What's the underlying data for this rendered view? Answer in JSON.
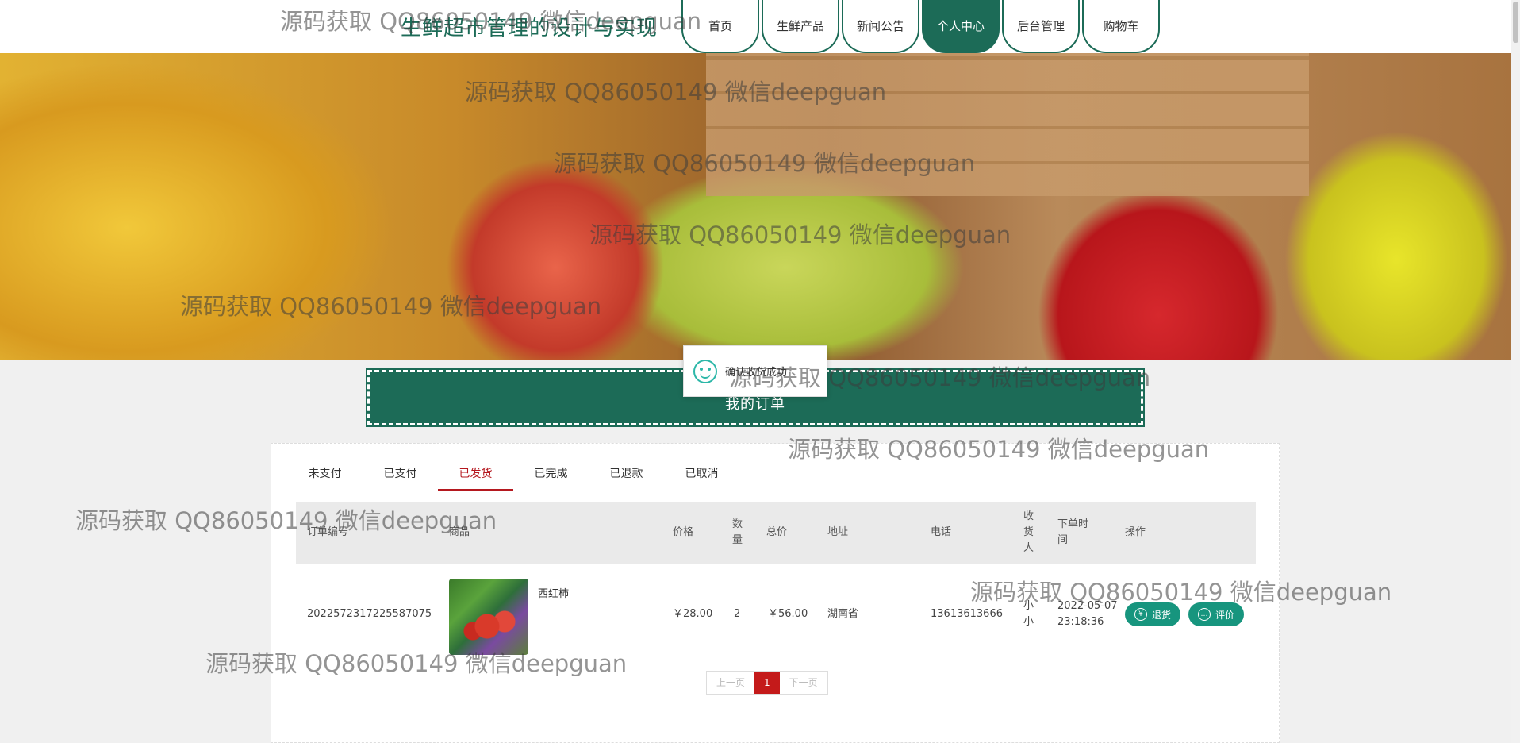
{
  "header": {
    "title": "生鲜超市管理的设计与实现",
    "nav": [
      {
        "label": "首页",
        "active": false
      },
      {
        "label": "生鲜产品",
        "active": false
      },
      {
        "label": "新闻公告",
        "active": false
      },
      {
        "label": "个人中心",
        "active": true
      },
      {
        "label": "后台管理",
        "active": false
      },
      {
        "label": "购物车",
        "active": false
      }
    ]
  },
  "toast": {
    "text": "确认收货成功"
  },
  "section": {
    "title": "我的订单"
  },
  "tabs": [
    "未支付",
    "已支付",
    "已发货",
    "已完成",
    "已退款",
    "已取消"
  ],
  "active_tab": "已发货",
  "table": {
    "headers": {
      "order_no": "订单编号",
      "product": "商品",
      "price": "价格",
      "qty": "数量",
      "total": "总价",
      "address": "地址",
      "phone": "电话",
      "receiver": "收货人",
      "time": "下单时间",
      "action": "操作"
    },
    "rows": [
      {
        "order_no": "2022572317225587075",
        "product": "西红柿",
        "price": "￥28.00",
        "qty": "2",
        "total": "￥56.00",
        "address": "湖南省",
        "phone": "13613613666",
        "receiver": "小小",
        "time": "2022-05-07 23:18:36",
        "actions": {
          "refund": "退货",
          "review": "评价"
        }
      }
    ]
  },
  "pager": {
    "prev": "上一页",
    "current": "1",
    "next": "下一页"
  },
  "watermark": "源码获取 QQ86050149 微信deepguan",
  "colors": {
    "primary": "#1c6b57",
    "accent_red": "#c41a1a",
    "button": "#17957e"
  }
}
